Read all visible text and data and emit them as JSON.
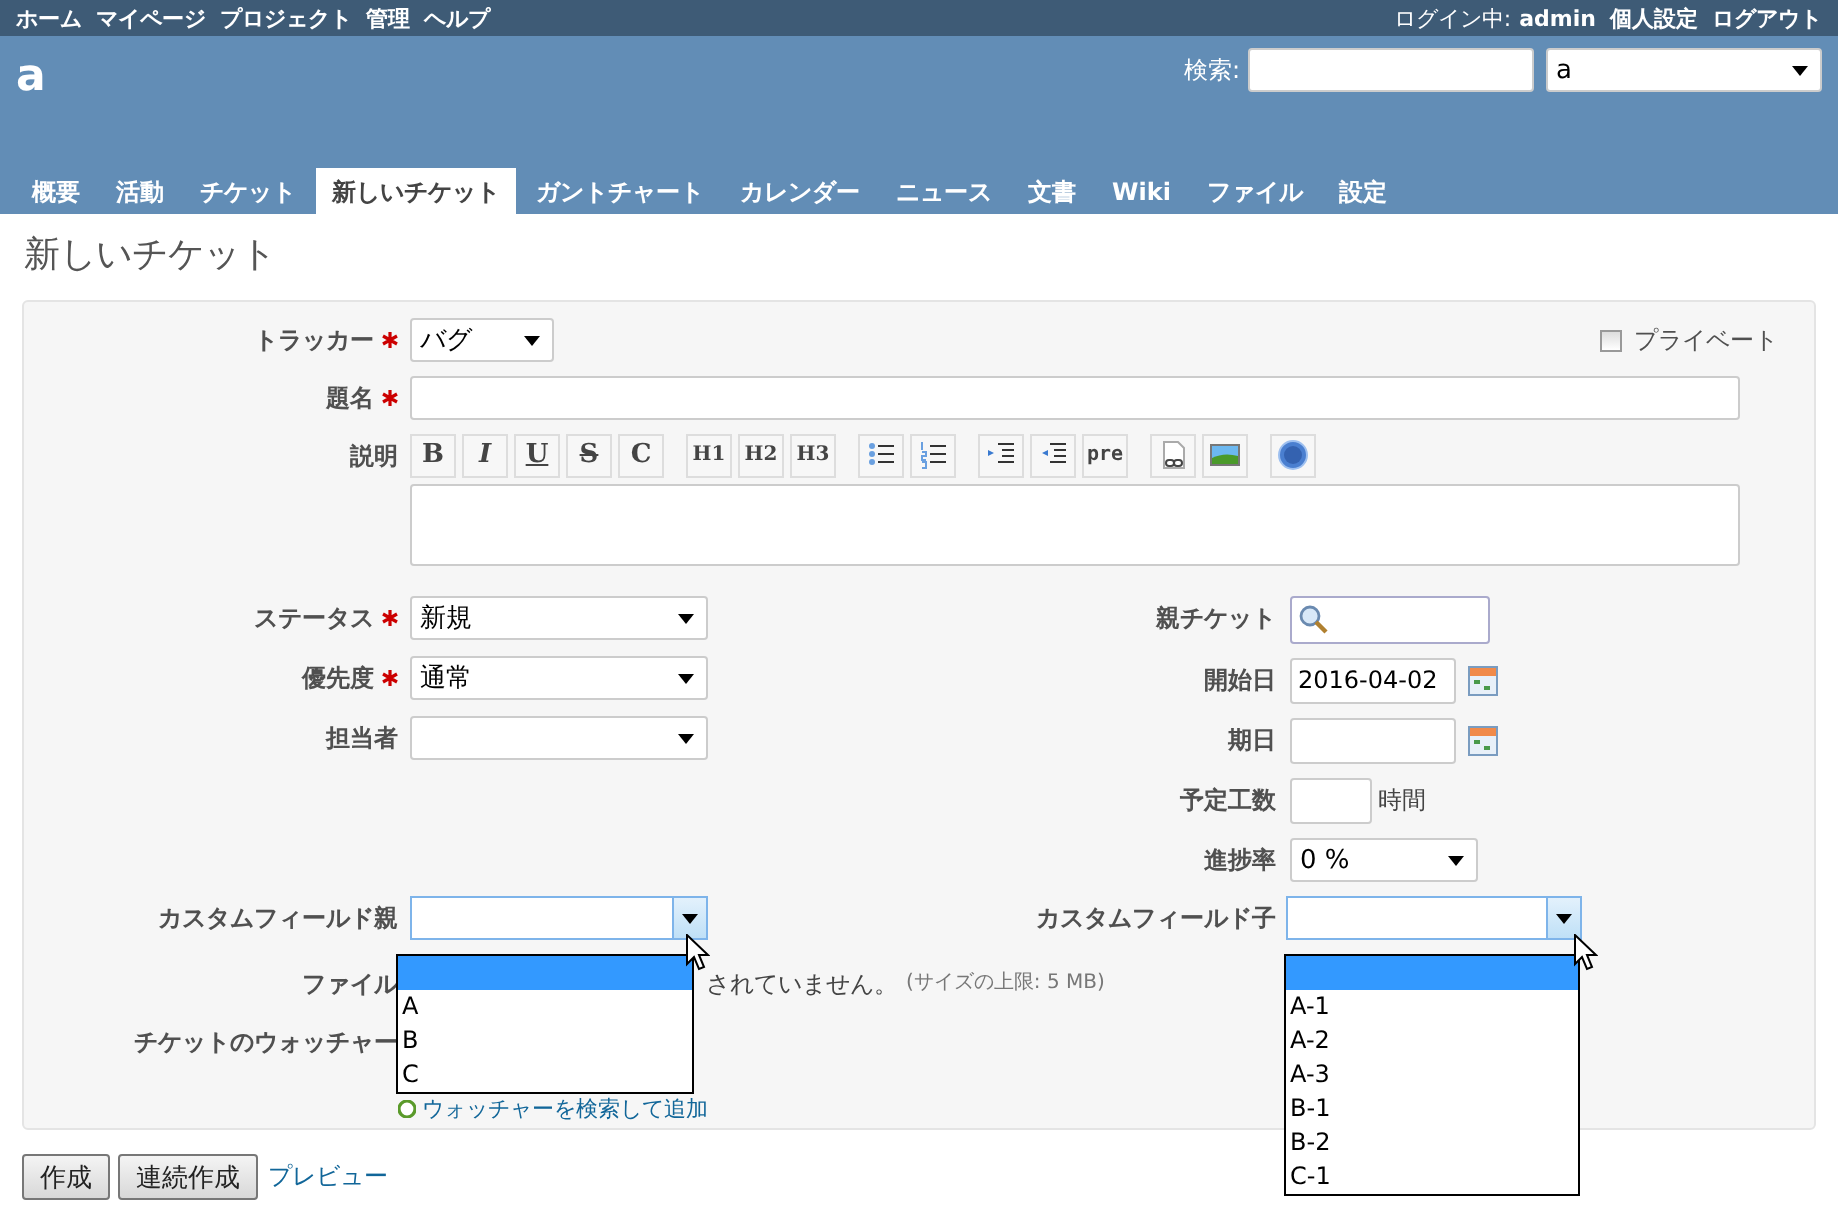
{
  "top_menu": {
    "items": [
      "ホーム",
      "マイページ",
      "プロジェクト",
      "管理",
      "ヘルプ"
    ],
    "logged_in_label": "ログイン中:",
    "user": "admin",
    "account_links": [
      "個人設定",
      "ログアウト"
    ]
  },
  "header": {
    "project_title": "a",
    "search_label": "検索:",
    "project_select": "a"
  },
  "tabs": [
    {
      "label": "概要",
      "selected": false
    },
    {
      "label": "活動",
      "selected": false
    },
    {
      "label": "チケット",
      "selected": false
    },
    {
      "label": "新しいチケット",
      "selected": true
    },
    {
      "label": "ガントチャート",
      "selected": false
    },
    {
      "label": "カレンダー",
      "selected": false
    },
    {
      "label": "ニュース",
      "selected": false
    },
    {
      "label": "文書",
      "selected": false
    },
    {
      "label": "Wiki",
      "selected": false
    },
    {
      "label": "ファイル",
      "selected": false
    },
    {
      "label": "設定",
      "selected": false
    }
  ],
  "page_title": "新しいチケット",
  "form": {
    "tracker": {
      "label": "トラッカー",
      "required": true,
      "value": "バグ"
    },
    "private": {
      "label": "プライベート",
      "checked": false
    },
    "subject": {
      "label": "題名",
      "required": true
    },
    "description": {
      "label": "説明",
      "toolbar": [
        {
          "kind": "bold",
          "label": "B"
        },
        {
          "kind": "italic",
          "label": "I"
        },
        {
          "kind": "underline",
          "label": "U"
        },
        {
          "kind": "strike",
          "label": "S"
        },
        {
          "kind": "code",
          "label": "C"
        },
        {
          "kind": "heading",
          "label": "H1"
        },
        {
          "kind": "heading",
          "label": "H2"
        },
        {
          "kind": "heading",
          "label": "H3"
        },
        {
          "kind": "bullets"
        },
        {
          "kind": "numbers"
        },
        {
          "kind": "indent"
        },
        {
          "kind": "outdent"
        },
        {
          "kind": "pre",
          "label": "pre"
        },
        {
          "kind": "link"
        },
        {
          "kind": "image"
        },
        {
          "kind": "help"
        }
      ]
    },
    "left_fields": [
      {
        "label": "ステータス",
        "required": true,
        "kind": "select",
        "value": "新規"
      },
      {
        "label": "優先度",
        "required": true,
        "kind": "select",
        "value": "通常"
      },
      {
        "label": "担当者",
        "required": false,
        "kind": "select"
      }
    ],
    "right_fields": [
      {
        "label": "親チケット",
        "kind": "search"
      },
      {
        "label": "開始日",
        "kind": "date",
        "value": "2016-04-02"
      },
      {
        "label": "期日",
        "kind": "date"
      },
      {
        "label": "予定工数",
        "kind": "hours",
        "unit": "時間"
      },
      {
        "label": "進捗率",
        "kind": "select",
        "value": "0 %"
      }
    ],
    "custom_parent": {
      "label": "カスタムフィールド親",
      "options": [
        {
          "selected": true
        },
        {
          "label": "A",
          "selected": false
        },
        {
          "label": "B",
          "selected": false
        },
        {
          "label": "C",
          "selected": false
        }
      ]
    },
    "custom_child": {
      "label": "カスタムフィールド子",
      "options": [
        {
          "selected": true
        },
        {
          "label": "A-1",
          "selected": false
        },
        {
          "label": "A-2",
          "selected": false
        },
        {
          "label": "A-3",
          "selected": false
        },
        {
          "label": "B-1",
          "selected": false
        },
        {
          "label": "B-2",
          "selected": false
        },
        {
          "label": "C-1",
          "selected": false
        }
      ]
    },
    "files": {
      "label": "ファイル",
      "status": "されていません。",
      "size_limit": "(サイズの上限: 5 MB)"
    },
    "watchers": {
      "label": "チケットのウォッチャー",
      "link": "ウォッチャーを検索して追加"
    }
  },
  "buttons": [
    "作成",
    "連続作成"
  ],
  "preview_link": "プレビュー"
}
